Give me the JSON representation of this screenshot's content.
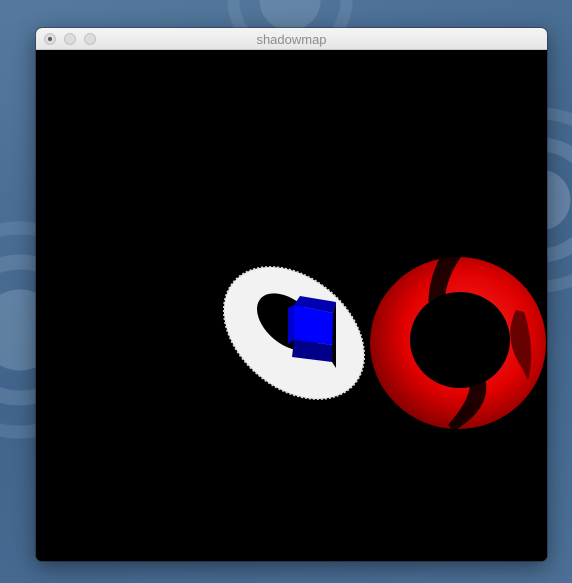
{
  "window": {
    "title": "shadowmap"
  },
  "scene": {
    "background_color": "#000000",
    "objects": [
      {
        "name": "floor-disc",
        "color": "#f2f2f2"
      },
      {
        "name": "cube",
        "color": "#0000ff"
      },
      {
        "name": "torus",
        "color": "#ff0000"
      }
    ],
    "shadow_color": "#000000"
  }
}
